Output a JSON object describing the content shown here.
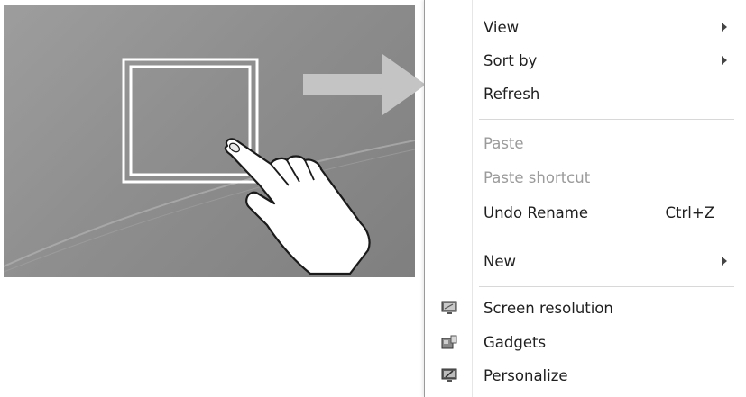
{
  "menu": {
    "items": [
      {
        "label": "View",
        "submenu": true
      },
      {
        "label": "Sort by",
        "submenu": true
      },
      {
        "label": "Refresh"
      },
      {
        "label": "Paste",
        "disabled": true
      },
      {
        "label": "Paste shortcut",
        "disabled": true
      },
      {
        "label": "Undo Rename",
        "shortcut": "Ctrl+Z"
      },
      {
        "label": "New",
        "submenu": true
      },
      {
        "label": "Screen resolution",
        "icon": "screen-resolution-icon"
      },
      {
        "label": "Gadgets",
        "icon": "gadgets-icon"
      },
      {
        "label": "Personalize",
        "icon": "personalize-icon"
      }
    ]
  },
  "colors": {
    "desktop": "#8e8e8e",
    "arrow": "#c4c4c4",
    "disabled_text": "#9b9b9b"
  },
  "illustration": {
    "gesture": "tap-and-hold",
    "hand_icon": "hand-pointer-icon"
  }
}
